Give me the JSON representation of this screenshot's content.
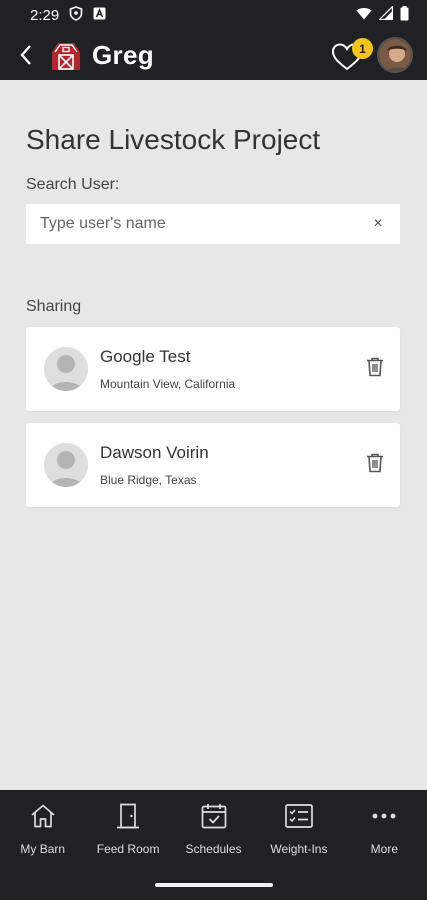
{
  "status": {
    "time": "2:29"
  },
  "app_bar": {
    "title": "Greg",
    "notification_count": "1"
  },
  "page": {
    "title": "Share Livestock Project",
    "search_label": "Search User:",
    "search_placeholder": "Type user's name",
    "search_value": "",
    "clear_label": "×",
    "sharing_label": "Sharing"
  },
  "sharing": [
    {
      "name": "Google Test",
      "location": "Mountain View, California"
    },
    {
      "name": "Dawson Voirin",
      "location": "Blue Ridge, Texas"
    }
  ],
  "nav": [
    {
      "label": "My Barn",
      "icon": "home-icon"
    },
    {
      "label": "Feed Room",
      "icon": "door-icon"
    },
    {
      "label": "Schedules",
      "icon": "calendar-check-icon"
    },
    {
      "label": "Weight-Ins",
      "icon": "checklist-icon"
    },
    {
      "label": "More",
      "icon": "more-dots-icon"
    }
  ],
  "colors": {
    "bar": "#1f2124",
    "background": "#e7e7e7",
    "badge": "#f5c518",
    "barn_red": "#b3262e"
  }
}
